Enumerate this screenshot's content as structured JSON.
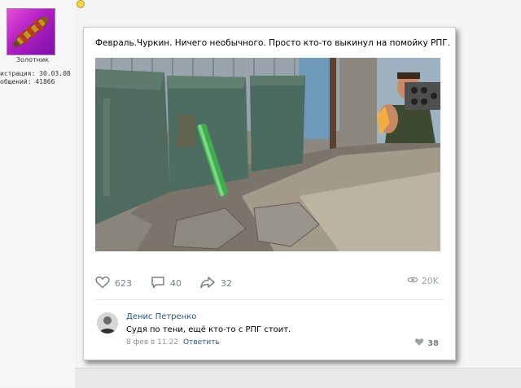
{
  "forum_user": {
    "rank": "Золотник",
    "reg_line": "истрация: 30.03.08",
    "posts_line": "общений: 41866"
  },
  "post": {
    "title": "Февраль.Чуркин. Ничего необычного. Просто кто-то выкинул на помойку РПГ.",
    "likes": "623",
    "comments": "40",
    "shares": "32",
    "views": "20K"
  },
  "comment": {
    "author": "Денис Петренко",
    "text": "Судя по тени, ещё кто-то с РПГ стоит.",
    "date": "8 фев в 11:22",
    "reply_label": "Ответить",
    "likes": "38"
  },
  "colors": {
    "link": "#2a5885",
    "icon_gray": "#7a7f86"
  },
  "icons": [
    "smiley-icon",
    "heart-icon",
    "comment-icon",
    "share-icon",
    "eye-icon"
  ]
}
